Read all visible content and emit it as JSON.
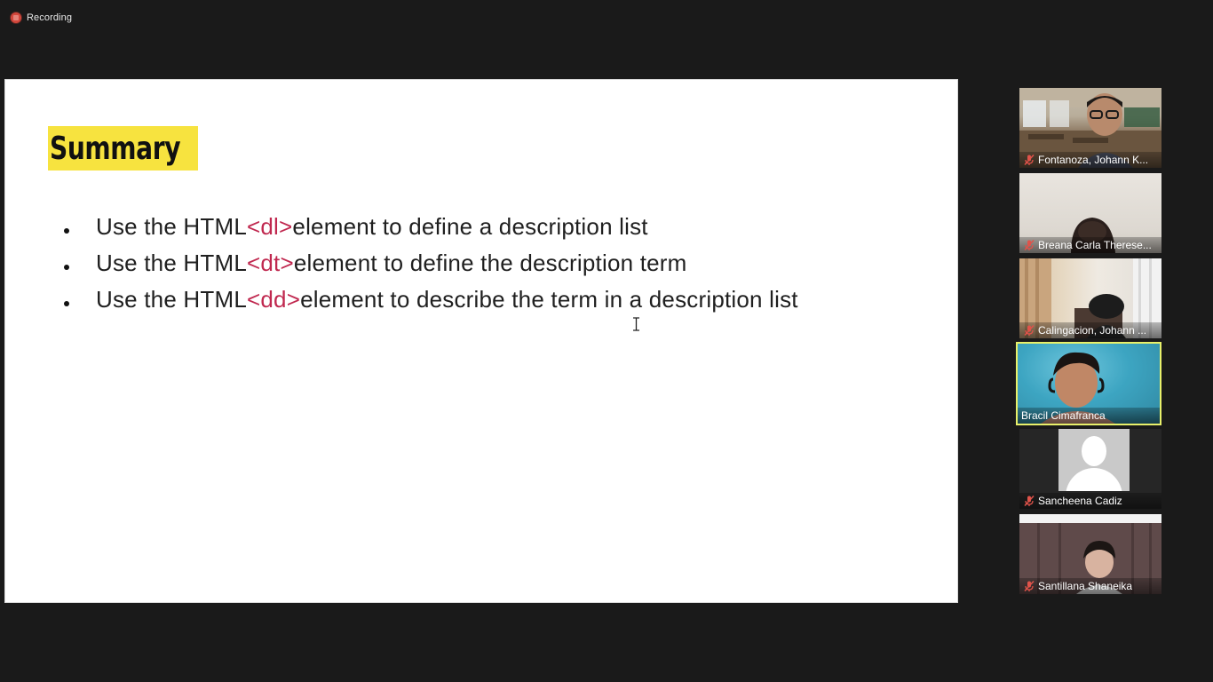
{
  "recording": {
    "label": "Recording"
  },
  "slide": {
    "title": "Summary",
    "bullets": [
      {
        "prefix": "Use the HTML ",
        "tag": "<dl>",
        "suffix": " element to define a description list"
      },
      {
        "prefix": "Use the HTML ",
        "tag": "<dt>",
        "suffix": " element to define the description term"
      },
      {
        "prefix": "Use the HTML ",
        "tag": "<dd>",
        "suffix": " element to describe the term in a description list"
      }
    ]
  },
  "participants": [
    {
      "name": "Fontanoza, Johann K...",
      "muted": true,
      "video": "classroom",
      "active": false
    },
    {
      "name": "Breana Carla Therese...",
      "muted": true,
      "video": "wall",
      "active": false
    },
    {
      "name": "Calingacion, Johann ...",
      "muted": true,
      "video": "room",
      "active": false
    },
    {
      "name": "Bracil Cimafranca",
      "muted": false,
      "video": "speaker",
      "active": true
    },
    {
      "name": "Sancheena Cadiz",
      "muted": true,
      "video": "none",
      "active": false
    },
    {
      "name": "Santillana Shaneika",
      "muted": true,
      "video": "curtain",
      "active": false
    }
  ],
  "colors": {
    "title_highlight": "#f7e33f",
    "tag": "#c0284f",
    "active_speaker_border": "#e8f06a",
    "mute_icon": "#e0534a"
  }
}
